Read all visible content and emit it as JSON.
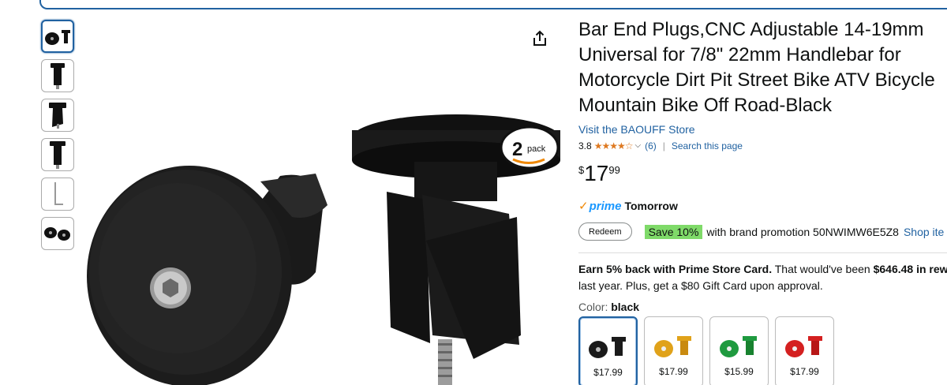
{
  "product": {
    "title": "Bar End Plugs,CNC Adjustable 14-19mm Universal for 7/8\" 22mm Handlebar for Motorcycle Dirt Pit Street Bike ATV Bicycle Mountain Bike Off Road-Black",
    "store_link": "Visit the BAOUFF Store",
    "rating": "3.8",
    "stars": "★★★★☆",
    "rating_count": "(6)",
    "separator": "|",
    "search_link": "Search this page",
    "price_symbol": "$",
    "price_whole": "17",
    "price_fraction": "99",
    "prime_label": "prime",
    "prime_delivery": "Tomorrow",
    "redeem_label": "Redeem",
    "save_badge": "Save 10%",
    "promo_text": "with brand promotion 50NWIMW6E5Z8",
    "shop_link": "Shop ite",
    "earn_bold": "Earn 5% back with Prime Store Card.",
    "earn_mid": " That would've been ",
    "earn_amount": "$646.48 in rew",
    "earn_tail": "last year. Plus, get a $80 Gift Card upon approval.",
    "color_label": "Color: ",
    "color_value": "black",
    "pack_badge": "2",
    "pack_word": "pack"
  },
  "swatches": [
    {
      "name": "black",
      "color": "#1a1a1a",
      "price": "$17.99"
    },
    {
      "name": "gold",
      "color": "#e0a21a",
      "price": "$17.99"
    },
    {
      "name": "green",
      "color": "#1f9a3f",
      "price": "$15.99"
    },
    {
      "name": "red",
      "color": "#d42020",
      "price": "$17.99"
    }
  ],
  "thumbnails": [
    "two-pieces",
    "side-view",
    "cut-view",
    "tall-view",
    "hex-key",
    "set-view"
  ],
  "icons": {
    "share": "share-icon"
  }
}
